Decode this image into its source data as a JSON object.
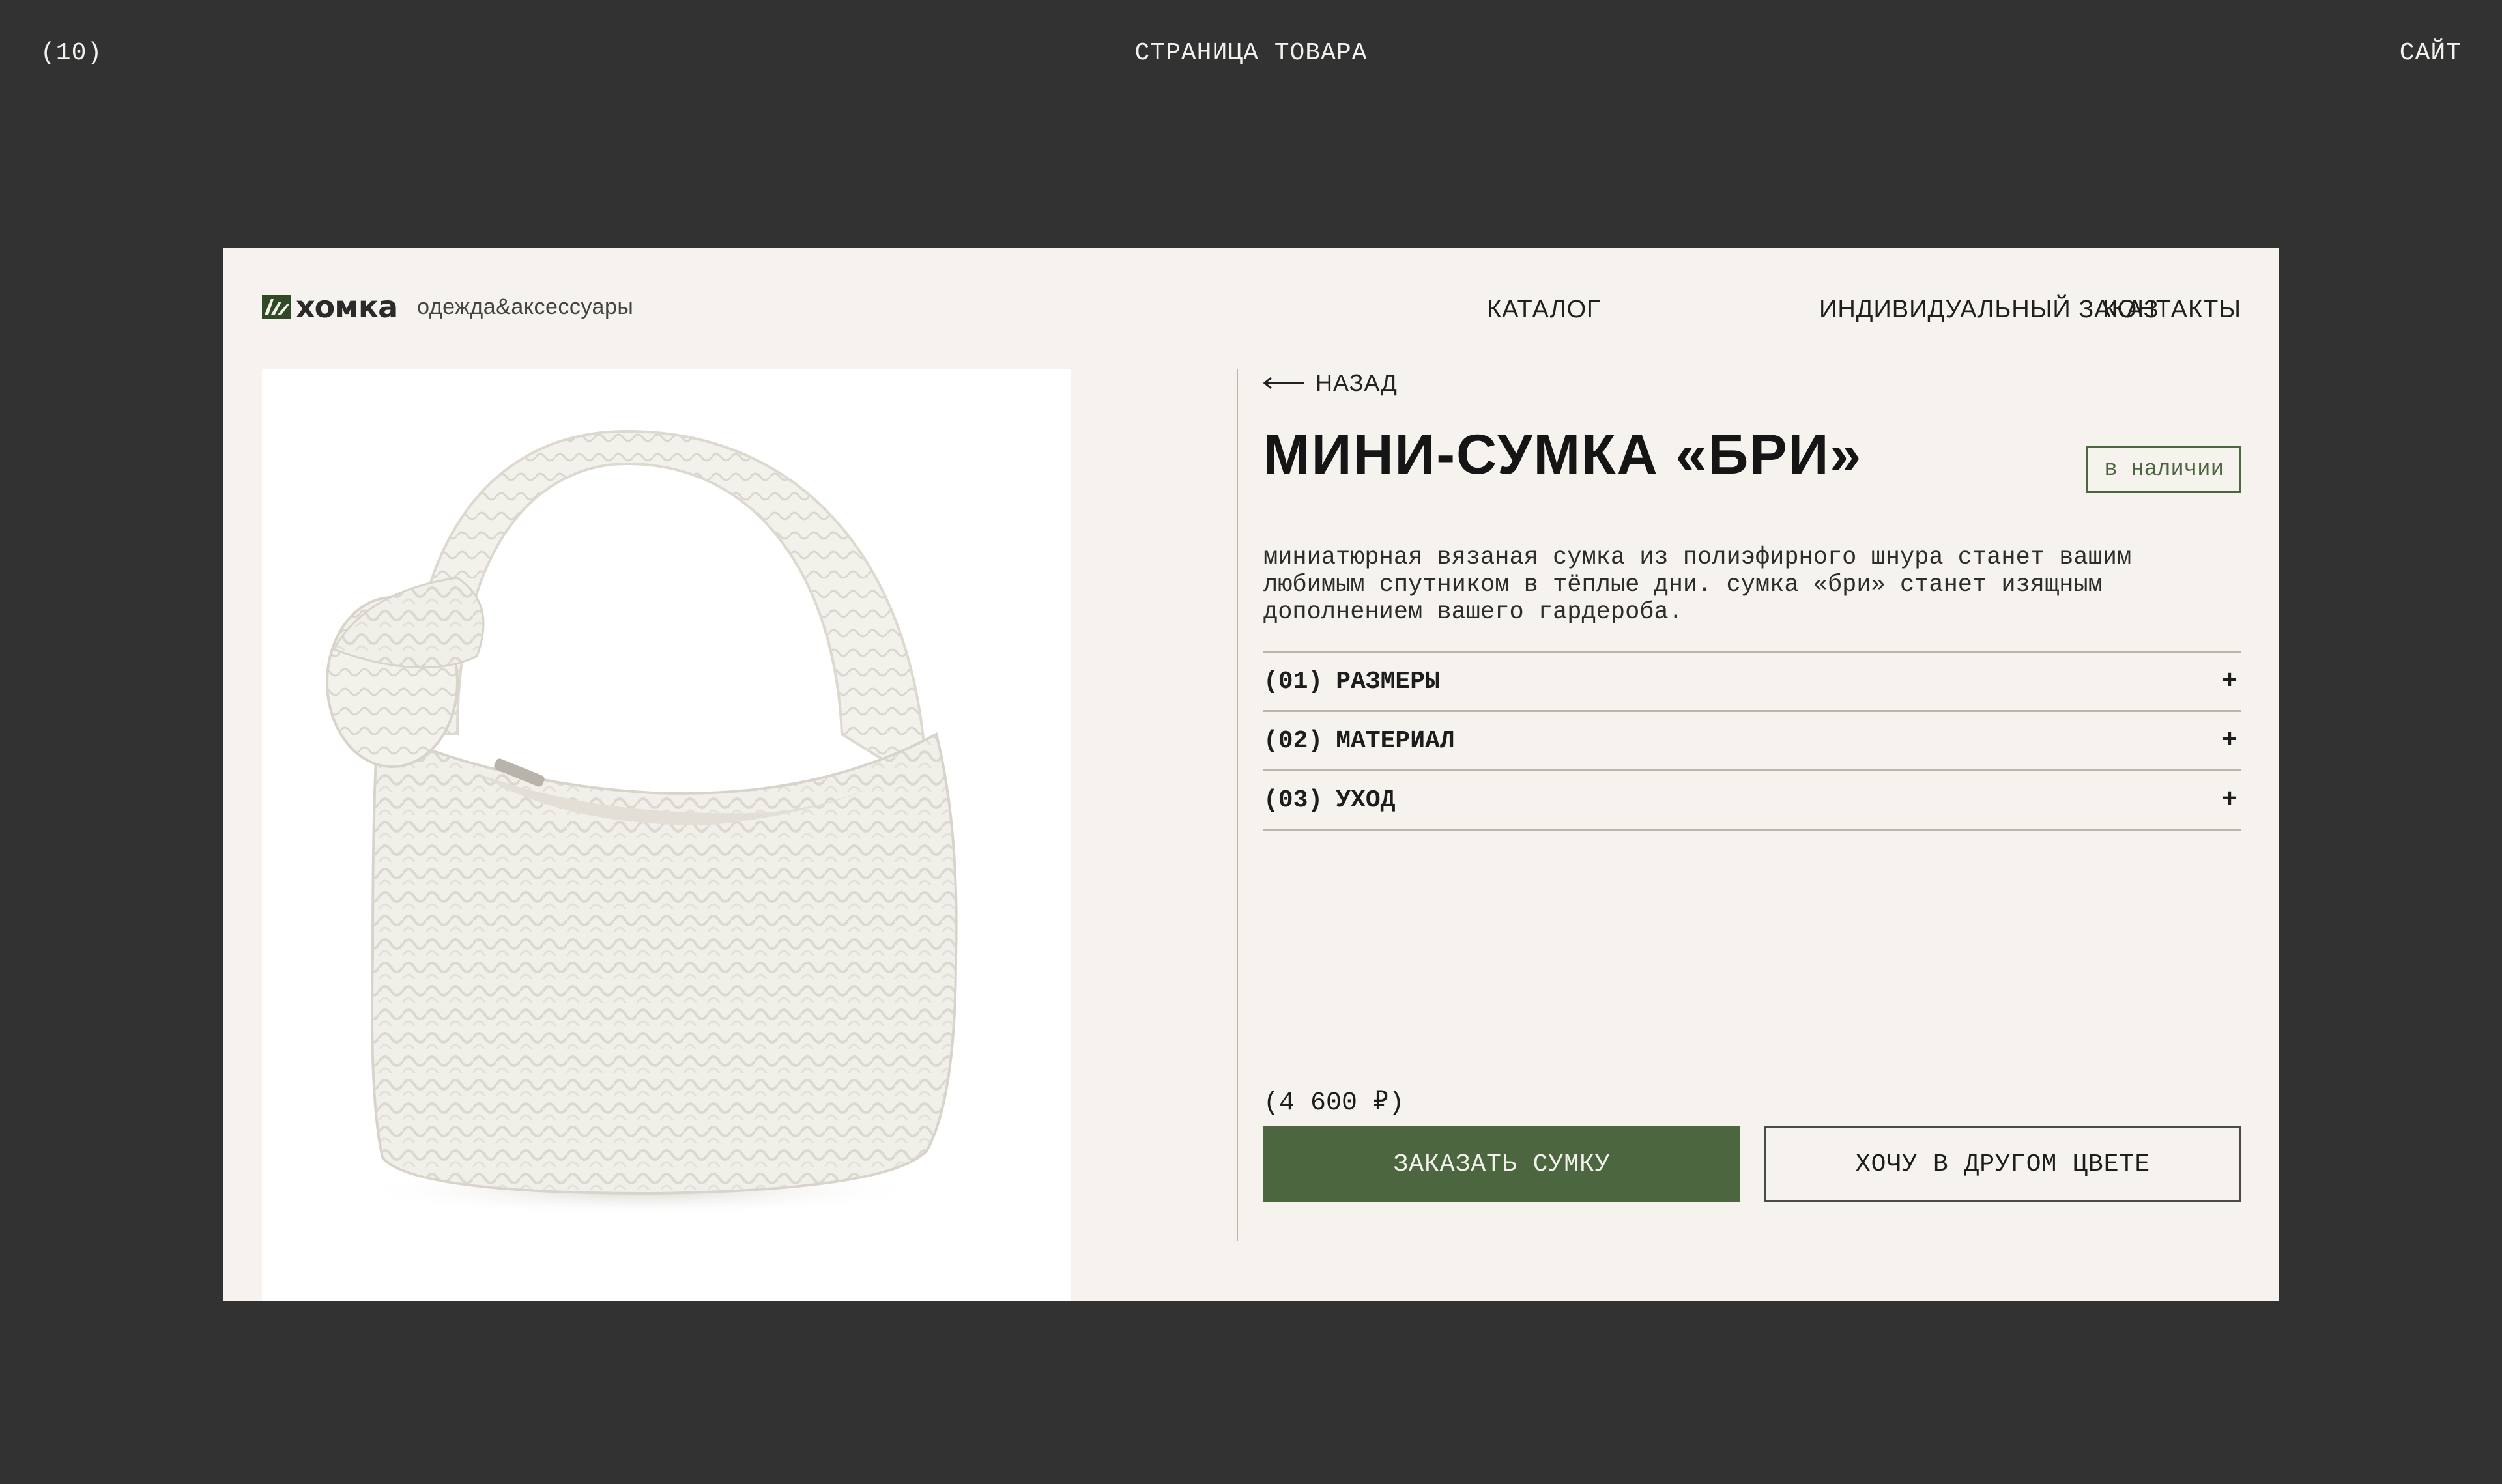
{
  "frame": {
    "left": "(10)",
    "center": "СТРАНИЦА ТОВАРА",
    "right": "САЙТ"
  },
  "header": {
    "logo_name": "хомка",
    "logo_tagline": "одежда&аксессуары",
    "nav": [
      "КАТАЛОГ",
      "ИНДИВИДУАЛЬНЫЙ ЗАКАЗ",
      "КОНТАКТЫ"
    ]
  },
  "product": {
    "back_label": "НАЗАД",
    "title": "МИНИ-СУМКА «БРИ»",
    "availability": "в наличии",
    "description": "миниатюрная вязаная сумка из полиэфирного шнура станет вашим любимым спутником в тёплые дни. сумка «бри» станет изящным дополнением вашего гардероба.",
    "sections": [
      {
        "number": "(01)",
        "label": "РАЗМЕРЫ",
        "icon": "+"
      },
      {
        "number": "(02)",
        "label": "МАТЕРИАЛ",
        "icon": "+"
      },
      {
        "number": "(03)",
        "label": "УХОД",
        "icon": "+"
      }
    ],
    "price": "(4 600 ₽)",
    "order_button": "ЗАКАЗАТЬ СУМКУ",
    "other_color_button": "ХОЧУ В ДРУГОМ ЦВЕТЕ"
  },
  "colors": {
    "background": "#323232",
    "card": "#f6f3ee",
    "accent": "#4c6640",
    "text": "#1a1a1a"
  }
}
